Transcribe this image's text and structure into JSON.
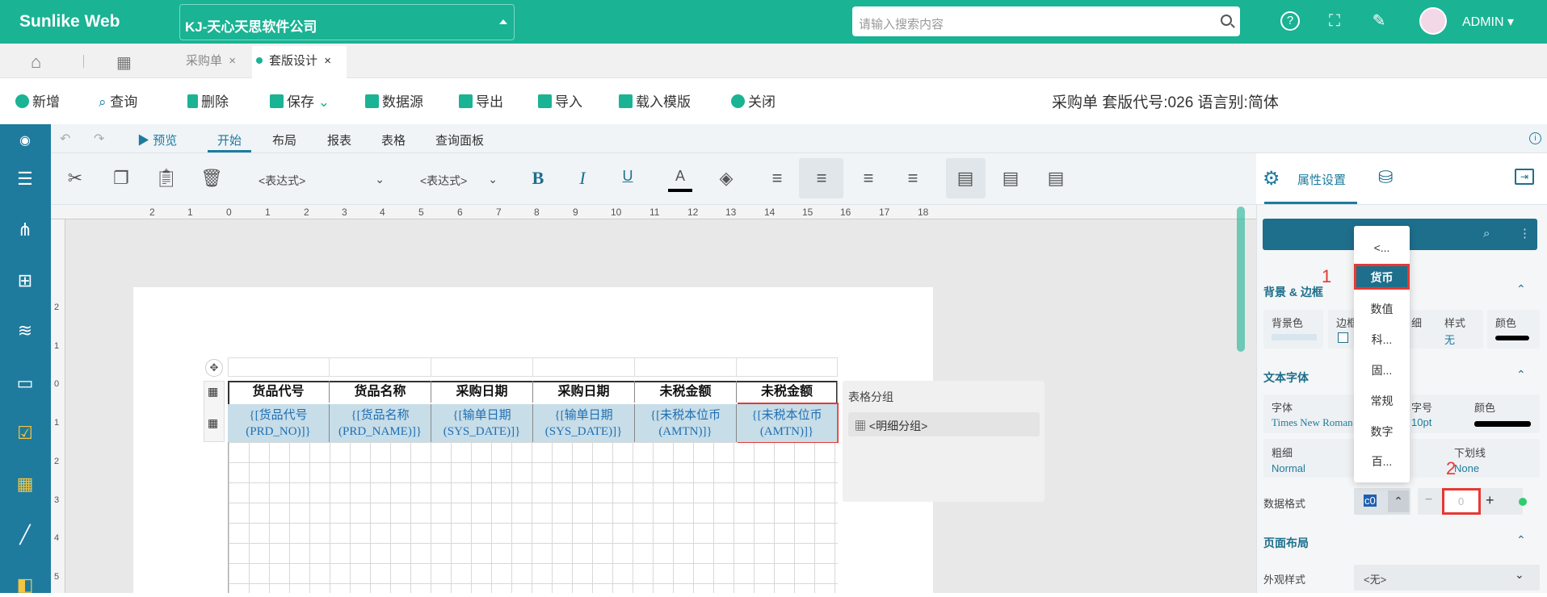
{
  "app": {
    "logo": "Sunlike Web",
    "company": "KJ-天心天思软件公司",
    "search_placeholder": "请输入搜索内容",
    "user": "ADMIN"
  },
  "tabs": {
    "purchase": "采购单",
    "design": "套版设计",
    "close": "×"
  },
  "toolbar": {
    "new": "新增",
    "query": "查询",
    "delete": "删除",
    "save": "保存",
    "datasource": "数据源",
    "export": "导出",
    "import": "导入",
    "load_template": "载入模版",
    "close": "关闭",
    "doc_title": "采购单 套版代号:026 语言别:简体"
  },
  "ribbon_tabs": {
    "preview": "预览",
    "start": "开始",
    "layout": "布局",
    "report": "报表",
    "table": "表格",
    "query_panel": "查询面板"
  },
  "ribbon": {
    "expr1": "<表达式>",
    "expr2": "<表达式>"
  },
  "table": {
    "headers": [
      "货品代号",
      "货品名称",
      "采购日期",
      "采购日期",
      "未税金额",
      "未税金额"
    ],
    "cells": [
      [
        "{[货品代号",
        "(PRD_NO)]}"
      ],
      [
        "{[货品名称",
        "(PRD_NAME)]}"
      ],
      [
        "{[输单日期",
        "(SYS_DATE)]}"
      ],
      [
        "{[输单日期",
        "(SYS_DATE)]}"
      ],
      [
        "{[未税本位币",
        "(AMTN)]}"
      ],
      [
        "{[未税本位币",
        "(AMTN)]}"
      ]
    ]
  },
  "groups": {
    "title": "表格分组",
    "item": "<明细分组>"
  },
  "ruler": {
    "h": [
      "2",
      "1",
      "0",
      "1",
      "2",
      "3",
      "4",
      "5",
      "6",
      "7",
      "8",
      "9",
      "10",
      "11",
      "12",
      "13",
      "14",
      "15",
      "16",
      "17",
      "18"
    ],
    "v": [
      "2",
      "1",
      "0",
      "1",
      "2",
      "3",
      "4",
      "5"
    ]
  },
  "panel": {
    "attr": "属性设置",
    "bg_border": "背景 & 边框",
    "bg_color": "背景色",
    "border": "边框",
    "style": "样式",
    "style_val": "无",
    "color": "颜色",
    "fine": "细",
    "text_font": "文本字体",
    "font": "字体",
    "font_val": "Times New Roman",
    "size": "字号",
    "size_val": "10pt",
    "color2": "颜色",
    "weight": "粗细",
    "weight_val": "Normal",
    "underline": "下划线",
    "underline_val": "None",
    "data_format": "数据格式",
    "fmt_code": "c0",
    "fmt_num": "0",
    "minus": "−",
    "plus": "+",
    "page_layout": "页面布局",
    "appearance": "外观样式",
    "appearance_val": "<无>"
  },
  "dropdown": {
    "items": [
      "<...",
      "货币",
      "数值",
      "科...",
      "固...",
      "常规",
      "数字",
      "百..."
    ]
  },
  "markers": {
    "m1": "1",
    "m2": "2"
  },
  "colors": {
    "brand": "#1ab394",
    "rail": "#1e7b9e",
    "highlight": "#e53935"
  }
}
